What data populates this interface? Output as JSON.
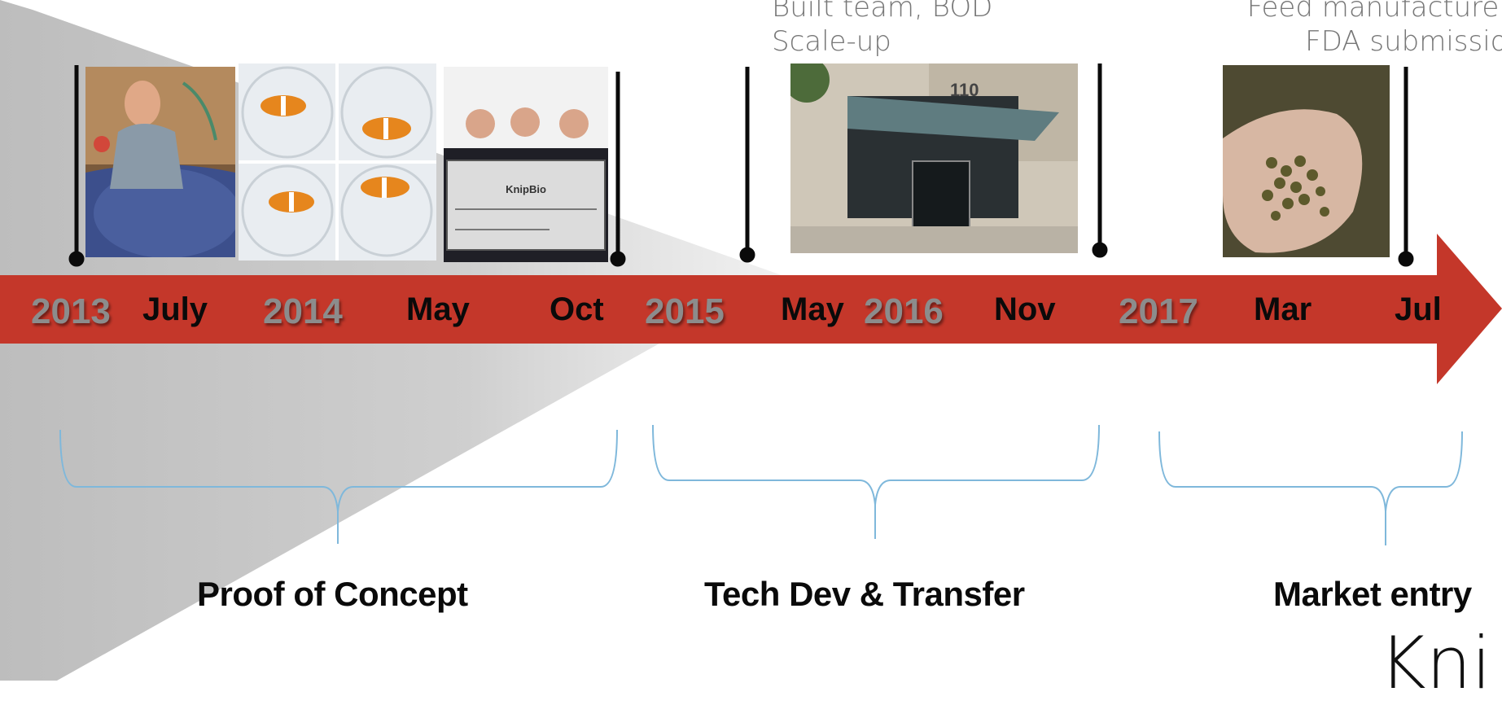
{
  "notes": {
    "left": [
      "Built team, BOD",
      "Scale-up"
    ],
    "right": [
      "Feed manufacturers",
      "FDA submission"
    ]
  },
  "timeline": {
    "years": [
      "2013",
      "2014",
      "2015",
      "2016",
      "2017"
    ],
    "months": [
      "July",
      "May",
      "Oct",
      "May",
      "Nov",
      "Mar",
      "Jul"
    ]
  },
  "phases": [
    "Proof of Concept",
    "Tech Dev & Transfer",
    "Market entry"
  ],
  "brand": "Kni",
  "colors": {
    "arrow": "#c4372a",
    "bracket": "#7fb8db",
    "wedge": "#c8c8c8",
    "year_text": "#8c8c8c"
  },
  "photos": [
    {
      "name": "researcher-at-tank-photo",
      "alt": "person working at fish tank"
    },
    {
      "name": "clownfish-dishes-photo",
      "alt": "four clownfish in petri dishes"
    },
    {
      "name": "check-presentation-photo",
      "alt": "group holding large check",
      "check_text": "KnipBio"
    },
    {
      "name": "building-entrance-photo",
      "alt": "building entrance",
      "number": "110"
    },
    {
      "name": "feed-pellets-photo",
      "alt": "hand holding feed pellets"
    }
  ]
}
